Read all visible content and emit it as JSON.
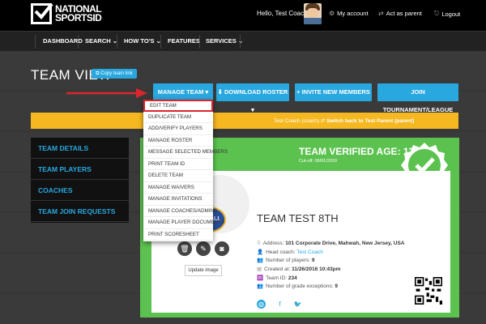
{
  "header": {
    "logo_line1": "NATIONAL",
    "logo_line2": "SPORTS",
    "logo_line2_id": "ID",
    "greeting": "Hello, Test Coach",
    "my_account": "My account",
    "act_as_parent": "Act as parent",
    "logout": "Logout"
  },
  "nav": {
    "dashboard": "DASHBOARD",
    "search": "SEARCH",
    "howtos": "HOW TO'S",
    "features": "FEATURES",
    "services": "SERVICES"
  },
  "page": {
    "title": "TEAM VIEW",
    "copy_link": "Copy team link"
  },
  "buttons": {
    "manage_team": "MANAGE TEAM",
    "download_roster": "DOWNLOAD ROSTER",
    "invite_members": "+ INVITE NEW MEMBERS",
    "join_tournament": "JOIN TOURNAMENT/LEAGUE"
  },
  "notice": {
    "prefix": "Test Coach (coach)",
    "link": "Switch back to Test Parent (parent)"
  },
  "dropdown": {
    "items": [
      "EDIT TEAM",
      "DUPLICATE TEAM",
      "ADD/VERIFY PLAYERS",
      "MANAGE ROSTER",
      "MESSAGE SELECTED MEMBERS",
      "PRINT TEAM ID",
      "DELETE TEAM",
      "MANAGE WAIVERS",
      "MANAGE INVITATIONS",
      "MANAGE COACHES/ADMINS",
      "MANAGE PLAYER DOCUMENTS",
      "PRINT SCORESHEET"
    ]
  },
  "sidebar": {
    "items": [
      "TEAM DETAILS",
      "TEAM PLAYERS",
      "COACHES",
      "TEAM JOIN REQUESTS"
    ]
  },
  "team": {
    "verified_age": "TEAM VERIFIED AGE: 13",
    "cutoff": "Cut-off: 09/01/2019",
    "name": "TEAM TEST 8TH",
    "update_image": "Update image",
    "address_label": "Address:",
    "address": "101 Corporate Drive, Mahwah, New Jersey, USA",
    "head_coach_label": "Head coach:",
    "head_coach": "Test Coach",
    "players_label": "Number of players:",
    "players": "9",
    "created_label": "Created at:",
    "created": "11/26/2016 10:43pm",
    "team_id_label": "Team ID:",
    "team_id": "234",
    "grade_exc_label": "Number of grade exceptions:",
    "grade_exc": "9",
    "logo_text": "ALL"
  },
  "colors": {
    "accent_blue": "#29a8e0",
    "panel_green": "#5cc24f",
    "notice_yellow": "#f5b820",
    "highlight_red": "#d9262d"
  }
}
